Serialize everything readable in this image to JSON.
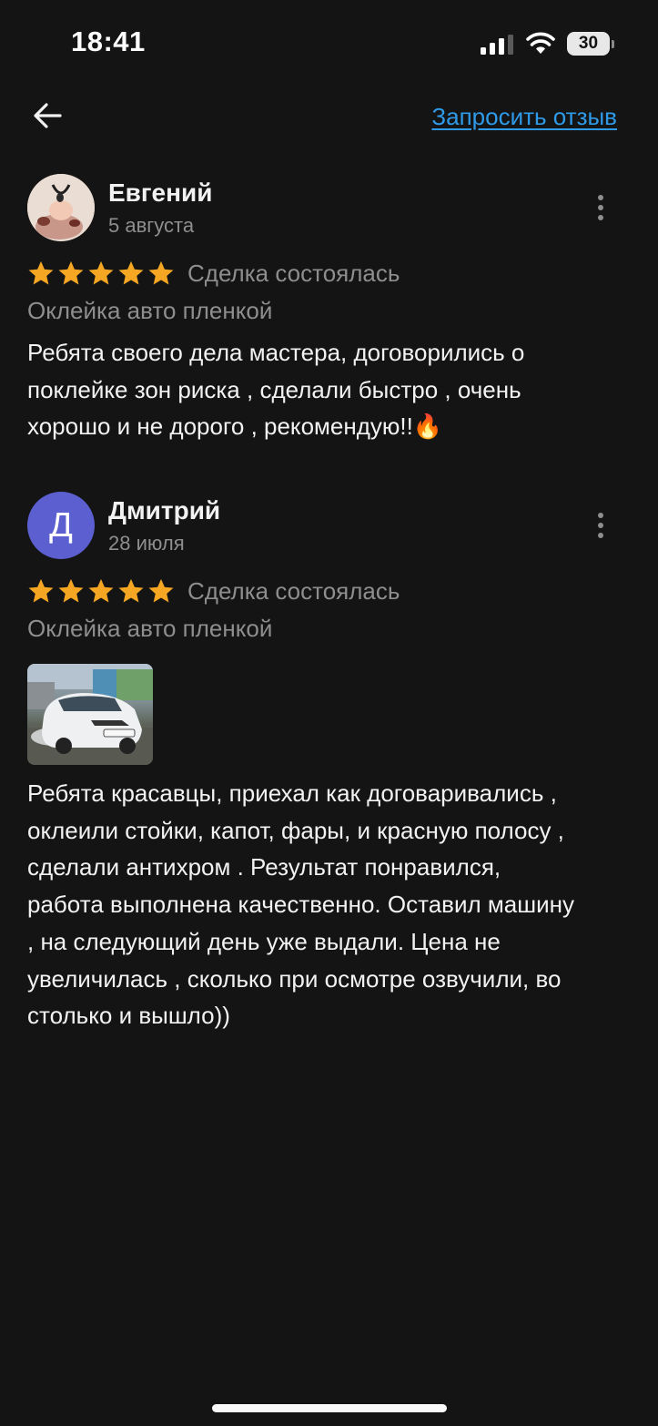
{
  "status_bar": {
    "time": "18:41",
    "battery": "30"
  },
  "header": {
    "request_review_label": "Запросить отзыв"
  },
  "reviews": [
    {
      "author": "Евгений",
      "date": "5 августа",
      "rating": 5,
      "deal_status": "Сделка состоялась",
      "service": "Оклейка авто пленкой",
      "text": "Ребята своего дела мастера, договорились о\nпоклейке зон риска , сделали быстро , очень\nхорошо и не дорого , рекомендую!!🔥"
    },
    {
      "author": "Дмитрий",
      "avatar_letter": "Д",
      "date": "28 июля",
      "rating": 5,
      "deal_status": "Сделка состоялась",
      "service": "Оклейка авто пленкой",
      "text": "Ребята красавцы, приехал как договаривались ,\nоклеили стойки, капот, фары, и красную полосу ,\nсделали антихром . Результат понравился,\nработа выполнена качественно. Оставил машину\n, на следующий день уже выдали.   Цена не\nувеличилась , сколько при осмотре озвучили, во\nстолько и вышло))"
    }
  ],
  "colors": {
    "accent_link": "#2f9ae8",
    "star": "#f5a623",
    "avatar_bg": "#5b5fcf",
    "background": "#141414"
  },
  "icons": {
    "back": "arrow-left-icon",
    "menu": "more-vertical-icon",
    "star": "star-icon"
  }
}
